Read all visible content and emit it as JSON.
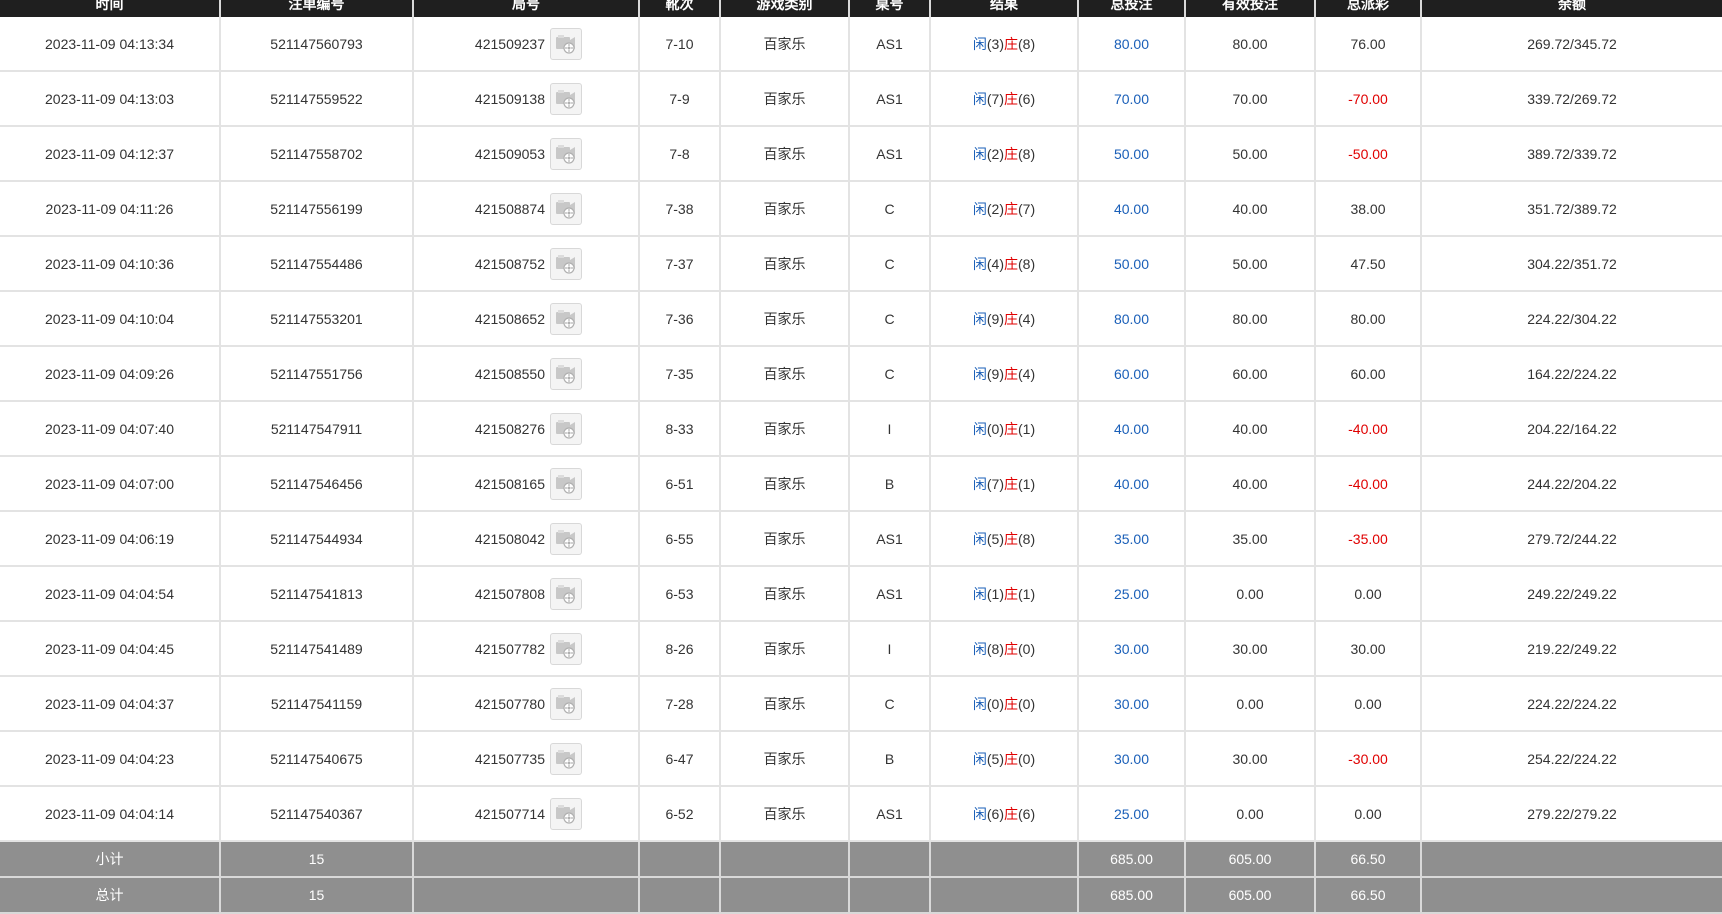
{
  "headers": [
    "时间",
    "注单编号",
    "局号",
    "靴次",
    "游戏类别",
    "桌号",
    "结果",
    "总投注",
    "有效投注",
    "总派彩",
    "余额"
  ],
  "rows": [
    {
      "time": "2023-11-09 04:13:34",
      "bet_id": "521147560793",
      "round": "421509237",
      "shoe": "7-10",
      "game": "百家乐",
      "table": "AS1",
      "player": "闲",
      "player_pts": "(3)",
      "banker": "庄",
      "banker_pts": "(8)",
      "total_bet": "80.00",
      "valid_bet": "80.00",
      "payout": "76.00",
      "payout_neg": false,
      "balance": "269.72/345.72"
    },
    {
      "time": "2023-11-09 04:13:03",
      "bet_id": "521147559522",
      "round": "421509138",
      "shoe": "7-9",
      "game": "百家乐",
      "table": "AS1",
      "player": "闲",
      "player_pts": "(7)",
      "banker": "庄",
      "banker_pts": "(6)",
      "total_bet": "70.00",
      "valid_bet": "70.00",
      "payout": "-70.00",
      "payout_neg": true,
      "balance": "339.72/269.72"
    },
    {
      "time": "2023-11-09 04:12:37",
      "bet_id": "521147558702",
      "round": "421509053",
      "shoe": "7-8",
      "game": "百家乐",
      "table": "AS1",
      "player": "闲",
      "player_pts": "(2)",
      "banker": "庄",
      "banker_pts": "(8)",
      "total_bet": "50.00",
      "valid_bet": "50.00",
      "payout": "-50.00",
      "payout_neg": true,
      "balance": "389.72/339.72"
    },
    {
      "time": "2023-11-09 04:11:26",
      "bet_id": "521147556199",
      "round": "421508874",
      "shoe": "7-38",
      "game": "百家乐",
      "table": "C",
      "player": "闲",
      "player_pts": "(2)",
      "banker": "庄",
      "banker_pts": "(7)",
      "total_bet": "40.00",
      "valid_bet": "40.00",
      "payout": "38.00",
      "payout_neg": false,
      "balance": "351.72/389.72"
    },
    {
      "time": "2023-11-09 04:10:36",
      "bet_id": "521147554486",
      "round": "421508752",
      "shoe": "7-37",
      "game": "百家乐",
      "table": "C",
      "player": "闲",
      "player_pts": "(4)",
      "banker": "庄",
      "banker_pts": "(8)",
      "total_bet": "50.00",
      "valid_bet": "50.00",
      "payout": "47.50",
      "payout_neg": false,
      "balance": "304.22/351.72"
    },
    {
      "time": "2023-11-09 04:10:04",
      "bet_id": "521147553201",
      "round": "421508652",
      "shoe": "7-36",
      "game": "百家乐",
      "table": "C",
      "player": "闲",
      "player_pts": "(9)",
      "banker": "庄",
      "banker_pts": "(4)",
      "total_bet": "80.00",
      "valid_bet": "80.00",
      "payout": "80.00",
      "payout_neg": false,
      "balance": "224.22/304.22"
    },
    {
      "time": "2023-11-09 04:09:26",
      "bet_id": "521147551756",
      "round": "421508550",
      "shoe": "7-35",
      "game": "百家乐",
      "table": "C",
      "player": "闲",
      "player_pts": "(9)",
      "banker": "庄",
      "banker_pts": "(4)",
      "total_bet": "60.00",
      "valid_bet": "60.00",
      "payout": "60.00",
      "payout_neg": false,
      "balance": "164.22/224.22"
    },
    {
      "time": "2023-11-09 04:07:40",
      "bet_id": "521147547911",
      "round": "421508276",
      "shoe": "8-33",
      "game": "百家乐",
      "table": "I",
      "player": "闲",
      "player_pts": "(0)",
      "banker": "庄",
      "banker_pts": "(1)",
      "total_bet": "40.00",
      "valid_bet": "40.00",
      "payout": "-40.00",
      "payout_neg": true,
      "balance": "204.22/164.22"
    },
    {
      "time": "2023-11-09 04:07:00",
      "bet_id": "521147546456",
      "round": "421508165",
      "shoe": "6-51",
      "game": "百家乐",
      "table": "B",
      "player": "闲",
      "player_pts": "(7)",
      "banker": "庄",
      "banker_pts": "(1)",
      "total_bet": "40.00",
      "valid_bet": "40.00",
      "payout": "-40.00",
      "payout_neg": true,
      "balance": "244.22/204.22"
    },
    {
      "time": "2023-11-09 04:06:19",
      "bet_id": "521147544934",
      "round": "421508042",
      "shoe": "6-55",
      "game": "百家乐",
      "table": "AS1",
      "player": "闲",
      "player_pts": "(5)",
      "banker": "庄",
      "banker_pts": "(8)",
      "total_bet": "35.00",
      "valid_bet": "35.00",
      "payout": "-35.00",
      "payout_neg": true,
      "balance": "279.72/244.22"
    },
    {
      "time": "2023-11-09 04:04:54",
      "bet_id": "521147541813",
      "round": "421507808",
      "shoe": "6-53",
      "game": "百家乐",
      "table": "AS1",
      "player": "闲",
      "player_pts": "(1)",
      "banker": "庄",
      "banker_pts": "(1)",
      "total_bet": "25.00",
      "valid_bet": "0.00",
      "payout": "0.00",
      "payout_neg": false,
      "balance": "249.22/249.22"
    },
    {
      "time": "2023-11-09 04:04:45",
      "bet_id": "521147541489",
      "round": "421507782",
      "shoe": "8-26",
      "game": "百家乐",
      "table": "I",
      "player": "闲",
      "player_pts": "(8)",
      "banker": "庄",
      "banker_pts": "(0)",
      "total_bet": "30.00",
      "valid_bet": "30.00",
      "payout": "30.00",
      "payout_neg": false,
      "balance": "219.22/249.22"
    },
    {
      "time": "2023-11-09 04:04:37",
      "bet_id": "521147541159",
      "round": "421507780",
      "shoe": "7-28",
      "game": "百家乐",
      "table": "C",
      "player": "闲",
      "player_pts": "(0)",
      "banker": "庄",
      "banker_pts": "(0)",
      "total_bet": "30.00",
      "valid_bet": "0.00",
      "payout": "0.00",
      "payout_neg": false,
      "balance": "224.22/224.22"
    },
    {
      "time": "2023-11-09 04:04:23",
      "bet_id": "521147540675",
      "round": "421507735",
      "shoe": "6-47",
      "game": "百家乐",
      "table": "B",
      "player": "闲",
      "player_pts": "(5)",
      "banker": "庄",
      "banker_pts": "(0)",
      "total_bet": "30.00",
      "valid_bet": "30.00",
      "payout": "-30.00",
      "payout_neg": true,
      "balance": "254.22/224.22"
    },
    {
      "time": "2023-11-09 04:04:14",
      "bet_id": "521147540367",
      "round": "421507714",
      "shoe": "6-52",
      "game": "百家乐",
      "table": "AS1",
      "player": "闲",
      "player_pts": "(6)",
      "banker": "庄",
      "banker_pts": "(6)",
      "total_bet": "25.00",
      "valid_bet": "0.00",
      "payout": "0.00",
      "payout_neg": false,
      "balance": "279.22/279.22"
    }
  ],
  "subtotal": {
    "label": "小计",
    "count": "15",
    "total_bet": "685.00",
    "valid_bet": "605.00",
    "payout": "66.50"
  },
  "grand_total": {
    "label": "总计",
    "count": "15",
    "total_bet": "685.00",
    "valid_bet": "605.00",
    "payout": "66.50"
  },
  "icons": {
    "replay": "video-replay-icon"
  },
  "colors": {
    "header_bg": "#1f1f1f",
    "footer_bg": "#8f8f8f",
    "blue": "#1a5fb8",
    "red": "#e00000"
  }
}
